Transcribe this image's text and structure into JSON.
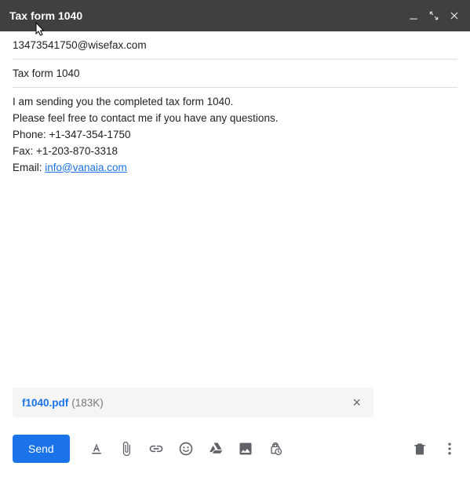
{
  "header": {
    "title": "Tax form 1040"
  },
  "to": "13473541750@wisefax.com",
  "subject": "Tax form 1040",
  "body": {
    "line1": "I am sending you the completed tax form 1040.",
    "line2": "Please feel free to contact me if you have any questions.",
    "phone_label": "Phone: ",
    "phone": "+1-347-354-1750",
    "fax_label": "Fax: ",
    "fax": "+1-203-870-3318",
    "email_label": "Email: ",
    "email_link": "info@vanaia.com"
  },
  "attachment": {
    "name": "f1040.pdf",
    "size": "(183K)"
  },
  "footer": {
    "send_label": "Send"
  }
}
